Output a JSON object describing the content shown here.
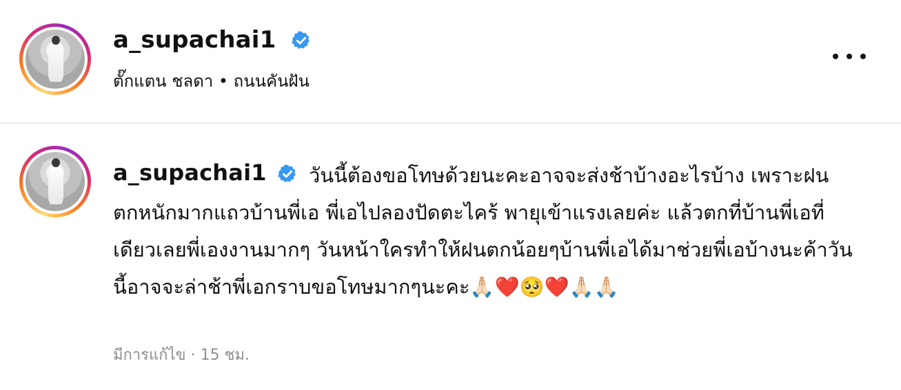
{
  "post": {
    "author": {
      "username": "a_supachai1",
      "verified": true,
      "avatar_icon": "profile-photo"
    },
    "subtitle": "ตั๊กแตน ชลดา • ถนนคันฝัน",
    "more_icon": "more-horizontal-icon"
  },
  "caption": {
    "username": "a_supachai1",
    "text": "วันนี้ต้องขอโทษด้วยนะคะอาจจะส่งช้าบ้างอะไรบ้าง เพราะฝนตกหนักมากแถวบ้านพี่เอ พี่เอไปลองปัดตะไคร้ พายุเข้าแรงเลยค่ะ แล้วตกที่บ้านพี่เอที่เดียวเลยพี่เองงานมากๆ วันหน้าใครทำให้ฝนตกน้อยๆบ้านพี่เอได้มาช่วยพี่เอบ้างนะค้าวันนี้อาจจะล่าช้าพี่เอกราบขอโทษมากๆนะคะ🙏🏻❤️🥺❤️🙏🏻🙏🏻",
    "meta": "มีการแก้ไข · 15 ชม."
  },
  "colors": {
    "verified_blue": "#3897f0",
    "meta_gray": "#8e8e8e",
    "text": "#111111"
  }
}
